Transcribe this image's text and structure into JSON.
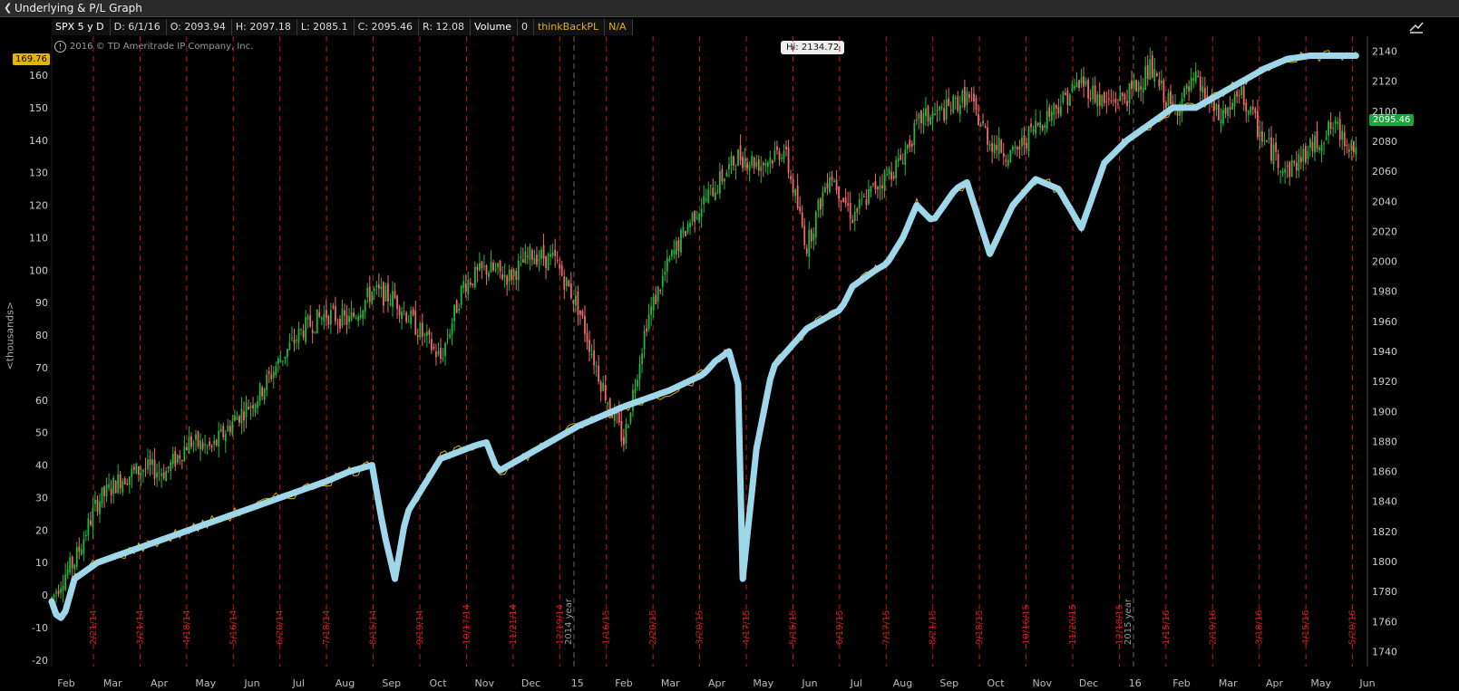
{
  "window": {
    "title": "Underlying & P/L Graph"
  },
  "infobar": {
    "symbol": "SPX 5 y D",
    "date": "D: 6/1/16",
    "open": "O: 2093.94",
    "high": "H: 2097.18",
    "low": "L: 2085.1",
    "close": "C: 2095.46",
    "range": "R: 12.08",
    "volume_label": "Volume",
    "volume_value": "0",
    "study_name": "thinkBackPL",
    "study_value": "N/A"
  },
  "copyright": "2016 © TD Ameritrade IP Company, Inc.",
  "left_axis": {
    "label": "<thousands>",
    "current_value": "169.76",
    "ticks": [
      "-20",
      "-10",
      "0",
      "10",
      "20",
      "30",
      "40",
      "50",
      "60",
      "70",
      "80",
      "90",
      "100",
      "110",
      "120",
      "130",
      "140",
      "150",
      "160"
    ]
  },
  "right_axis": {
    "current_value": "2095.46",
    "ticks": [
      "1740",
      "1760",
      "1780",
      "1800",
      "1820",
      "1840",
      "1860",
      "1880",
      "1900",
      "1920",
      "1940",
      "1960",
      "1980",
      "2000",
      "2020",
      "2040",
      "2060",
      "2080",
      "2100",
      "2120",
      "2140"
    ]
  },
  "high_label": "Hi: 2134.72",
  "colors": {
    "background": "#000000",
    "up_candle": "#22b83a",
    "down_candle": "#f06a6a",
    "pl_line": "#9fd7ea",
    "pl_thin": "#e0b000",
    "expiry_line": "#c21818"
  },
  "chart_data": {
    "type": "line",
    "title": "",
    "xlabel": "",
    "ylabel": "<thousands>",
    "x_months": [
      "Feb",
      "Mar",
      "Apr",
      "May",
      "Jun",
      "Jul",
      "Aug",
      "Sep",
      "Oct",
      "Nov",
      "Dec",
      "15",
      "Feb",
      "Mar",
      "Apr",
      "May",
      "Jun",
      "Jul",
      "Aug",
      "Sep",
      "Oct",
      "Nov",
      "Dec",
      "16",
      "Feb",
      "Mar",
      "Apr",
      "May",
      "Jun"
    ],
    "expiration_dates": [
      "2/21/14",
      "3/21/14",
      "4/18/14",
      "5/16/14",
      "6/20/14",
      "7/18/14",
      "8/15/14",
      "9/19/14",
      "10/17/14",
      "11/21/14",
      "12/19/14",
      "1/16/15",
      "2/20/15",
      "3/20/15",
      "4/17/15",
      "5/15/15",
      "6/19/15",
      "7/17/15",
      "8/21/15",
      "9/18/15",
      "10/16/15",
      "11/20/15",
      "12/18/15",
      "1/15/16",
      "2/19/16",
      "3/18/16",
      "4/15/16",
      "5/20/16"
    ],
    "year_markers": [
      "2014 year",
      "2015 year"
    ],
    "series": [
      {
        "name": "SPX 5 y D",
        "axis": "right",
        "ylim": [
          1730,
          2150
        ],
        "x": [
          0,
          5,
          10,
          20,
          30,
          40,
          50,
          60,
          70,
          80,
          90,
          100,
          110,
          120,
          130,
          140,
          150,
          160,
          170,
          180,
          190,
          200,
          210,
          220,
          230,
          240,
          250,
          260,
          270,
          280,
          290,
          300,
          310,
          320,
          330,
          340,
          350,
          360,
          370,
          380,
          390,
          400,
          410,
          420,
          430,
          440,
          450,
          460,
          470,
          480,
          490,
          500,
          510,
          520,
          530,
          540,
          550,
          560,
          570
        ],
        "values": [
          1775,
          1790,
          1800,
          1840,
          1855,
          1862,
          1860,
          1880,
          1875,
          1895,
          1910,
          1935,
          1955,
          1965,
          1960,
          1980,
          1975,
          1955,
          1935,
          1985,
          1995,
          1990,
          2005,
          2000,
          1970,
          1920,
          1880,
          1960,
          2000,
          2030,
          2050,
          2070,
          2065,
          2075,
          2010,
          2060,
          2030,
          2050,
          2065,
          2095,
          2100,
          2110,
          2080,
          2070,
          2090,
          2105,
          2120,
          2105,
          2110,
          2128,
          2100,
          2120,
          2095,
          2110,
          2080,
          2060,
          2075,
          2090,
          2075
        ]
      },
      {
        "name": "thinkBackPL",
        "axis": "left",
        "ylim": [
          -22,
          172
        ],
        "x": [
          0,
          3,
          6,
          10,
          20,
          40,
          60,
          80,
          100,
          120,
          130,
          140,
          145,
          150,
          155,
          170,
          185,
          190,
          195,
          210,
          230,
          250,
          270,
          285,
          290,
          296,
          300,
          302,
          308,
          315,
          330,
          345,
          350,
          360,
          365,
          372,
          378,
          385,
          395,
          400,
          410,
          420,
          430,
          440,
          450,
          460,
          470,
          480,
          490,
          500,
          510,
          520,
          530,
          540,
          550,
          560,
          570
        ],
        "values": [
          -2,
          -8,
          -5,
          5,
          10,
          15,
          20,
          25,
          30,
          35,
          38,
          40,
          20,
          5,
          25,
          42,
          46,
          47,
          38,
          44,
          52,
          58,
          63,
          68,
          72,
          75,
          65,
          5,
          45,
          70,
          82,
          88,
          95,
          100,
          102,
          110,
          120,
          115,
          125,
          127,
          105,
          120,
          128,
          125,
          113,
          133,
          140,
          145,
          150,
          150,
          154,
          158,
          162,
          165,
          166,
          166,
          166
        ]
      }
    ]
  }
}
